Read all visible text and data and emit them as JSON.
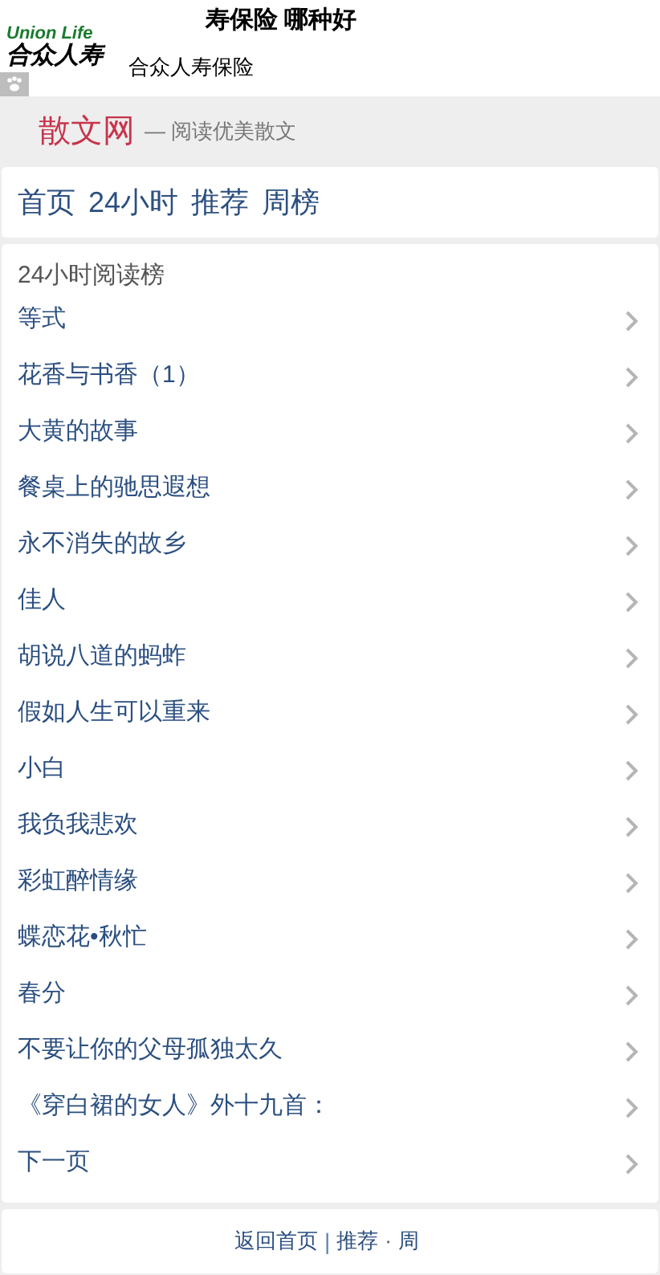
{
  "ad": {
    "headline": "寿保险 哪种好",
    "logo_en": "Union Life",
    "logo_cn": "合众人寿",
    "subtitle": "合众人寿保险"
  },
  "header": {
    "site_name": "散文网",
    "tagline": "— 阅读优美散文"
  },
  "nav": [
    "首页",
    "24小时",
    "推荐",
    "周榜"
  ],
  "list": {
    "title": "24小时阅读榜",
    "items": [
      "等式",
      "花香与书香（1）",
      "大黄的故事",
      "餐桌上的驰思遐想",
      "永不消失的故乡",
      "佳人",
      "胡说八道的蚂蚱",
      "假如人生可以重来",
      "小白",
      "我负我悲欢",
      "彩虹醉情缘",
      "蝶恋花•秋忙",
      "春分",
      "不要让你的父母孤独太久",
      "《穿白裙的女人》外十九首：",
      "下一页"
    ]
  },
  "footer": [
    {
      "kind": "link",
      "text": "返回首页"
    },
    {
      "kind": "separator",
      "text": "|"
    },
    {
      "kind": "link",
      "text": "推荐"
    },
    {
      "kind": "text",
      "text": "·"
    },
    {
      "kind": "link",
      "text": "周"
    }
  ]
}
